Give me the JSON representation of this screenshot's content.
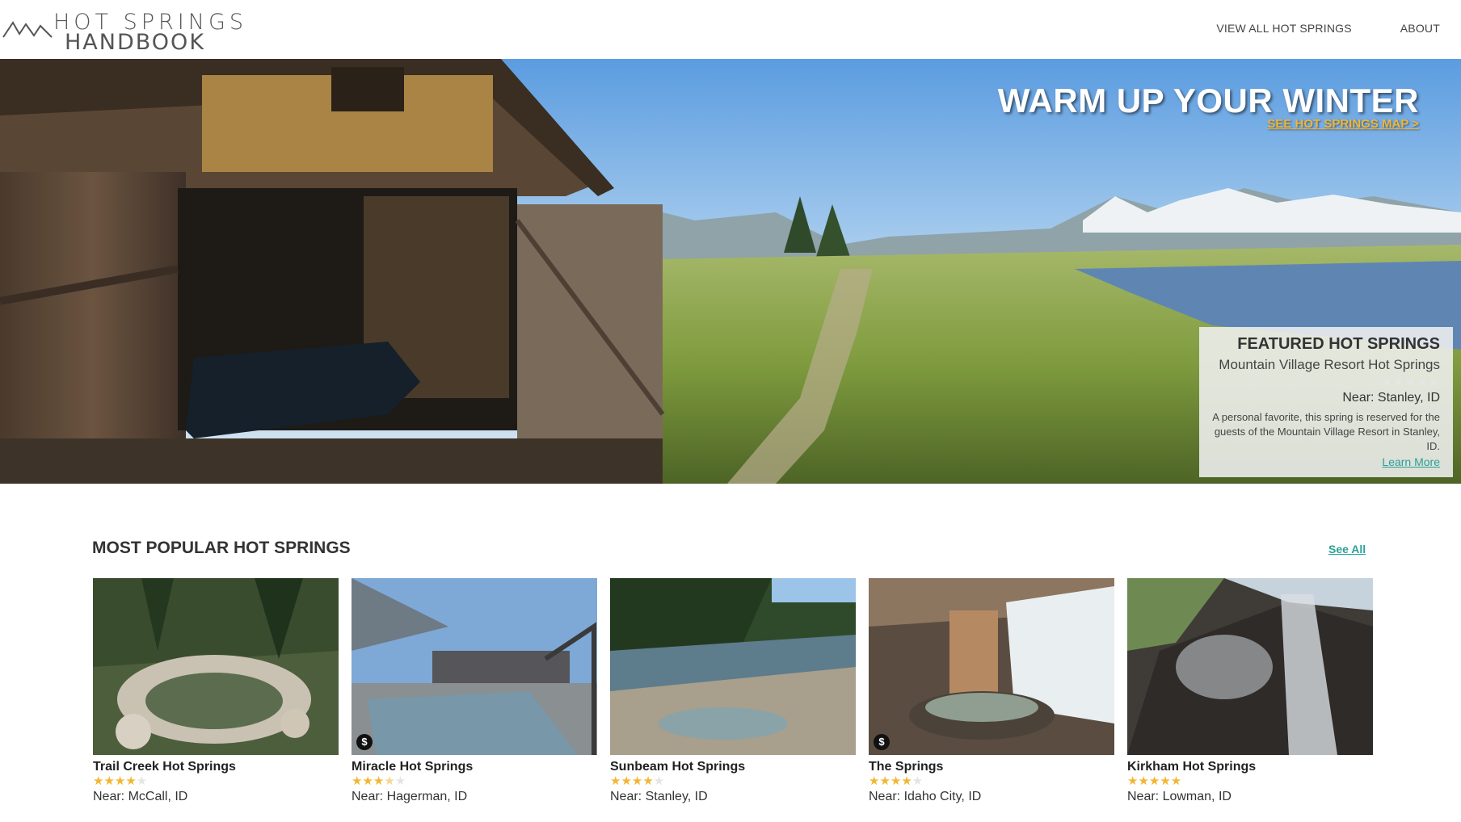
{
  "header": {
    "logo_line1": "HOT SPRINGS",
    "logo_line2": "HANDBOOK",
    "nav": [
      {
        "label": "VIEW ALL HOT SPRINGS"
      },
      {
        "label": "ABOUT"
      }
    ]
  },
  "hero": {
    "title": "WARM UP YOUR WINTER",
    "link": "SEE HOT SPRINGS MAP >",
    "featured": {
      "title": "FEATURED HOT SPRINGS",
      "name": "Mountain Village Resort Hot Springs",
      "rating": 0,
      "near": "Near: Stanley, ID",
      "description": "A personal favorite, this spring is reserved for the guests of the Mountain Village Resort in Stanley, ID.",
      "learn_more": "Learn More"
    }
  },
  "popular": {
    "title": "MOST POPULAR HOT SPRINGS",
    "see_all": "See All",
    "cards": [
      {
        "name": "Trail Creek Hot Springs",
        "rating": 4,
        "near": "Near: McCall, ID",
        "price_badge": "",
        "image": "rocky-pool-in-forest"
      },
      {
        "name": "Miracle Hot Springs",
        "rating": 3.5,
        "near": "Near: Hagerman, ID",
        "price_badge": "$",
        "image": "outdoor-pool-with-bathers"
      },
      {
        "name": "Sunbeam Hot Springs",
        "rating": 4,
        "near": "Near: Stanley, ID",
        "price_badge": "",
        "image": "river-with-bathers"
      },
      {
        "name": "The Springs",
        "rating": 4,
        "near": "Near: Idaho City, ID",
        "price_badge": "$",
        "image": "snowy-hot-tub"
      },
      {
        "name": "Kirkham Hot Springs",
        "rating": 5,
        "near": "Near: Lowman, ID",
        "price_badge": "",
        "image": "steaming-waterfall"
      }
    ]
  },
  "colors": {
    "accent_teal": "#2aa198",
    "star_gold": "#f2b632",
    "hero_link": "#f2b632"
  }
}
